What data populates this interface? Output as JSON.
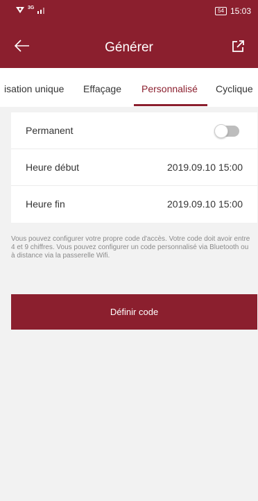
{
  "status_bar": {
    "network": "3G",
    "battery": "54",
    "time": "15:03"
  },
  "toolbar": {
    "title": "Générer",
    "back_icon": "arrow-left-icon",
    "share_icon": "external-link-icon"
  },
  "tabs": [
    {
      "label": "isation unique",
      "active": false
    },
    {
      "label": "Effaçage",
      "active": false
    },
    {
      "label": "Personnalisé",
      "active": true
    },
    {
      "label": "Cyclique",
      "active": false
    }
  ],
  "settings": {
    "permanent": {
      "label": "Permanent",
      "enabled": false
    },
    "start": {
      "label": "Heure début",
      "value": "2019.09.10 15:00"
    },
    "end": {
      "label": "Heure fin",
      "value": "2019.09.10 15:00"
    }
  },
  "info_text": "Vous pouvez configurer votre propre code d'accès. Votre code doit avoir entre 4 et 9 chiffres. Vous pouvez configurer un code personnalisé via Bluetooth ou à distance via la passerelle Wifi.",
  "primary_button": "Définir code",
  "colors": {
    "brand": "#8b1f2e",
    "background": "#f2f2f2",
    "text_muted": "#8a8a8a"
  }
}
